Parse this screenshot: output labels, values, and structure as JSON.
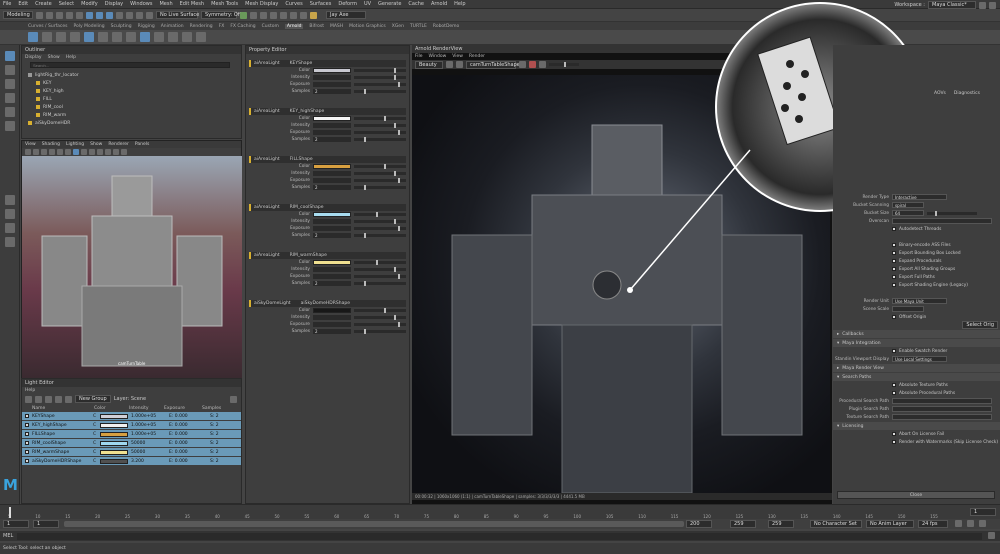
{
  "menubar": [
    "File",
    "Edit",
    "Create",
    "Select",
    "Modify",
    "Display",
    "Windows",
    "Mesh",
    "Edit Mesh",
    "Mesh Tools",
    "Mesh Display",
    "Curves",
    "Surfaces",
    "Deform",
    "UV",
    "Generate",
    "Cache",
    "Arnold",
    "Help"
  ],
  "workspace": {
    "label": "Workspace :",
    "value": "Maya Classic*"
  },
  "toolbar": {
    "mode": "Modeling",
    "live_surface": "No Live Surface",
    "symmetry": "Symmetry: Off",
    "camera_select": "Jay Axe"
  },
  "shelf_tabs": [
    "Curves / Surfaces",
    "Poly Modeling",
    "Sculpting",
    "Rigging",
    "Animation",
    "Rendering",
    "FX",
    "FX Caching",
    "Custom",
    "Arnold",
    "Bifrost",
    "MASH",
    "Motion Graphics",
    "XGen",
    "TURTLE",
    "RobotDemo"
  ],
  "shelf_active": "Arnold",
  "outliner": {
    "title": "Outliner",
    "menu": [
      "Display",
      "Show",
      "Help"
    ],
    "search_placeholder": "Search...",
    "items": [
      "lightRig_thr_locator",
      "KEY",
      "KEY_high",
      "FILL",
      "RIM_cool",
      "RIM_warm",
      "aiSkyDomeHDR"
    ]
  },
  "viewport": {
    "menu": [
      "View",
      "Shading",
      "Lighting",
      "Show",
      "Renderer",
      "Panels"
    ],
    "camera_label": "camTurnTable"
  },
  "light_editor": {
    "title": "Light Editor",
    "menu": [
      "Help"
    ],
    "new_group": "New Group",
    "layer": "Layer: Scene",
    "columns": [
      "Name",
      "Color",
      "Intensity",
      "Exposure",
      "Samples"
    ],
    "rows": [
      {
        "name": "KEYShape",
        "intensity": "1.000e+05",
        "exposure": "E: 0.000",
        "samples": "S: 2",
        "color": "#d0d0d8"
      },
      {
        "name": "KEY_highShape",
        "intensity": "1.000e+05",
        "exposure": "E: 0.000",
        "samples": "S: 2",
        "color": "#f0f0f0"
      },
      {
        "name": "FILLShape",
        "intensity": "1.000e+05",
        "exposure": "E: 0.000",
        "samples": "S: 2",
        "color": "#d8a040"
      },
      {
        "name": "RIM_coolShape",
        "intensity": "50000",
        "exposure": "E: 0.000",
        "samples": "S: 2",
        "color": "#a0d8f0"
      },
      {
        "name": "RIM_warmShape",
        "intensity": "50000",
        "exposure": "E: 0.000",
        "samples": "S: 2",
        "color": "#f0e090"
      },
      {
        "name": "aiSkyDomeHDRShape",
        "intensity": "3.200",
        "exposure": "E: 0.000",
        "samples": "S: 2",
        "color": "#505050"
      }
    ]
  },
  "property_editor": {
    "title": "Property Editor",
    "field_labels": [
      "Color",
      "Intensity",
      "Exposure",
      "Samples"
    ],
    "lights": [
      {
        "type": "aiAreaLight",
        "name": "KEYShape",
        "color": "#c8c8d0",
        "samples": "2"
      },
      {
        "type": "aiAreaLight",
        "name": "KEY_highShape",
        "color": "#f4f4f4",
        "samples": "2"
      },
      {
        "type": "aiAreaLight",
        "name": "FILLShape",
        "color": "#d8a040",
        "samples": "2"
      },
      {
        "type": "aiAreaLight",
        "name": "RIM_coolShape",
        "color": "#a8dcf0",
        "samples": "2"
      },
      {
        "type": "aiAreaLight",
        "name": "RIM_warmShape",
        "color": "#f0e090",
        "samples": "2"
      },
      {
        "type": "aiSkyDomeLight",
        "name": "aiSkyDomeHDRShape",
        "color": "#181818",
        "samples": "2"
      }
    ]
  },
  "render_view": {
    "title": "Arnold RenderView",
    "menu": [
      "File",
      "Window",
      "View",
      "Render"
    ],
    "aov": "Beauty",
    "camera": "camTurnTableShape",
    "status": "00:00:32 | 1060x1060 (1:1) | camTurnTableShape | samples: 3/3/3/3/3/3 | 4441.5 MB"
  },
  "arnold_panel": {
    "tabs": [
      "AOVs",
      "Diagnostics"
    ],
    "rows": [
      {
        "label": "Render Type",
        "value": "Interactive"
      },
      {
        "label": "Bucket Scanning",
        "value": "spiral"
      },
      {
        "label": "Bucket Size",
        "value": "64"
      },
      {
        "label": "Overscan",
        "value": ""
      }
    ],
    "checks": [
      "Autodetect Threads",
      "Binary-encode ASS Files",
      "Export Bounding Box Locked",
      "Expand Procedurals",
      "Export All Shading Groups",
      "Export Full Paths",
      "Export Shading Engine (Legacy)"
    ],
    "render_unit": {
      "label": "Render Unit",
      "value": "Use Maya Unit"
    },
    "scene_scale": "Scene Scale",
    "offset_origin": "Offset Origin",
    "select_origin": "Select Orig",
    "sections": [
      "Callbacks",
      "Maya Integration",
      "Maya Render View",
      "Search Paths",
      "Licensing"
    ],
    "enable_swatch": "Enable Swatch Render",
    "standin": {
      "label": "Standin Viewport Display",
      "value": "Use Local Settings"
    },
    "abs_texture": "Absolute Texture Paths",
    "abs_proc": "Absolute Procedural Paths",
    "paths": [
      "Procedural Search Path",
      "Plugin Search Path",
      "Texture Search Path"
    ],
    "abort_license": "Abort On License Fail",
    "watermarks": "Render with Watermarks (Skip License Check)",
    "close": "Close"
  },
  "timeline": {
    "ticks": [
      "5",
      "10",
      "15",
      "20",
      "25",
      "30",
      "35",
      "40",
      "45",
      "50",
      "55",
      "60",
      "65",
      "70",
      "75",
      "80",
      "85",
      "90",
      "95",
      "100",
      "105",
      "110",
      "115",
      "120",
      "125",
      "130",
      "135",
      "140",
      "145",
      "150",
      "155"
    ],
    "current": "1"
  },
  "range_bar": {
    "start": "1",
    "start2": "1",
    "end": "200",
    "end2": "259",
    "end3": "259",
    "char_set": "No Character Set",
    "anim_layer": "No Anim Layer",
    "fps": "24 fps"
  },
  "mel": {
    "label": "MEL"
  },
  "help_line": "Select Tool: select an object"
}
